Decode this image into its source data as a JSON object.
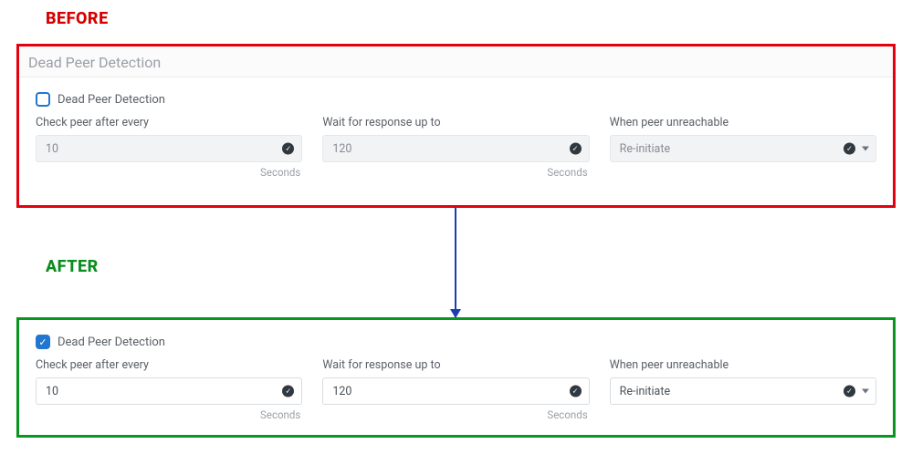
{
  "labels": {
    "before": "BEFORE",
    "after": "AFTER"
  },
  "before": {
    "section_title": "Dead Peer Detection",
    "checkbox_label": "Dead Peer Detection",
    "checked": false,
    "fields": {
      "check_peer": {
        "label": "Check peer after every",
        "value": "10",
        "unit": "Seconds"
      },
      "wait_response": {
        "label": "Wait for response up to",
        "value": "120",
        "unit": "Seconds"
      },
      "when_unreachable": {
        "label": "When peer unreachable",
        "value": "Re-initiate"
      }
    }
  },
  "after": {
    "checkbox_label": "Dead Peer Detection",
    "checked": true,
    "fields": {
      "check_peer": {
        "label": "Check peer after every",
        "value": "10",
        "unit": "Seconds"
      },
      "wait_response": {
        "label": "Wait for response up to",
        "value": "120",
        "unit": "Seconds"
      },
      "when_unreachable": {
        "label": "When peer unreachable",
        "value": "Re-initiate"
      }
    }
  }
}
